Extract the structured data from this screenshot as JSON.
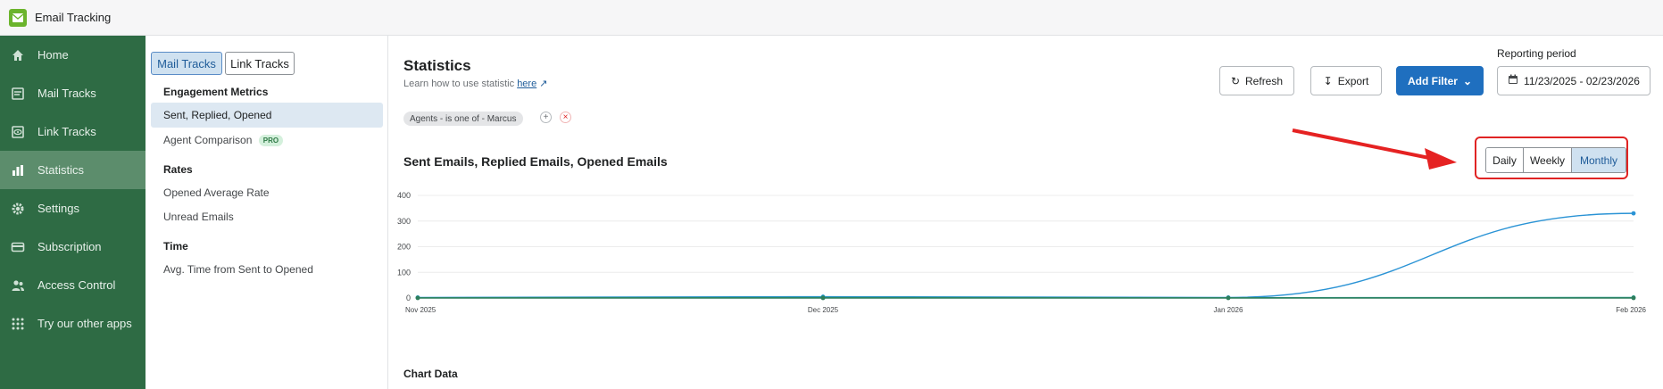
{
  "app": {
    "title": "Email Tracking"
  },
  "sidebar": {
    "items": [
      {
        "label": "Home",
        "icon": "home-icon"
      },
      {
        "label": "Mail Tracks",
        "icon": "mail-tracks-icon"
      },
      {
        "label": "Link Tracks",
        "icon": "link-tracks-icon"
      },
      {
        "label": "Statistics",
        "icon": "statistics-icon",
        "active": true
      },
      {
        "label": "Settings",
        "icon": "gear-icon"
      },
      {
        "label": "Subscription",
        "icon": "card-icon"
      },
      {
        "label": "Access Control",
        "icon": "users-icon"
      },
      {
        "label": "Try our other apps",
        "icon": "grid-icon"
      }
    ]
  },
  "subnav": {
    "tabs": [
      {
        "label": "Mail Tracks",
        "active": true
      },
      {
        "label": "Link Tracks",
        "active": false
      }
    ],
    "engagement_heading": "Engagement Metrics",
    "sent_replied_opened": "Sent, Replied, Opened",
    "agent_comparison": "Agent Comparison",
    "pro_badge": "PRO",
    "rates_heading": "Rates",
    "opened_average_rate": "Opened Average Rate",
    "unread_emails": "Unread Emails",
    "time_heading": "Time",
    "avg_time": "Avg. Time from Sent to Opened"
  },
  "main": {
    "title": "Statistics",
    "help_text": "Learn how to use statistic",
    "help_link": "here",
    "refresh_label": "Refresh",
    "export_label": "Export",
    "add_filter_label": "Add Filter",
    "reporting_period_label": "Reporting period",
    "reporting_period_value": "11/23/2025 - 02/23/2026",
    "filter_chip": "Agents - is one of - Marcus",
    "chart_title": "Sent Emails, Replied Emails, Opened Emails",
    "range": [
      {
        "label": "Daily",
        "active": false
      },
      {
        "label": "Weekly",
        "active": false
      },
      {
        "label": "Monthly",
        "active": true
      }
    ],
    "chart_data_heading": "Chart Data"
  },
  "colors": {
    "sidebar_bg": "#2e6b44",
    "sidebar_active": "#5c8d6c",
    "primary": "#1f6fbf",
    "series_blue": "#2a93d5",
    "series_teal": "#1a9a8a",
    "highlight_red": "#e02424"
  },
  "chart_data": {
    "type": "line",
    "categories": [
      "Nov 2025",
      "Dec 2025",
      "Jan 2026",
      "Feb 2026"
    ],
    "yticks": [
      0,
      100,
      200,
      300,
      400
    ],
    "ylim": [
      0,
      400
    ],
    "series": [
      {
        "values": [
          2,
          5,
          2,
          330
        ],
        "color": "#2a93d5"
      },
      {
        "values": [
          1,
          2,
          1,
          2
        ],
        "color": "#1a9a8a"
      },
      {
        "values": [
          0,
          0,
          0,
          0
        ],
        "color": "#2e7d5b"
      }
    ],
    "grid": true
  }
}
